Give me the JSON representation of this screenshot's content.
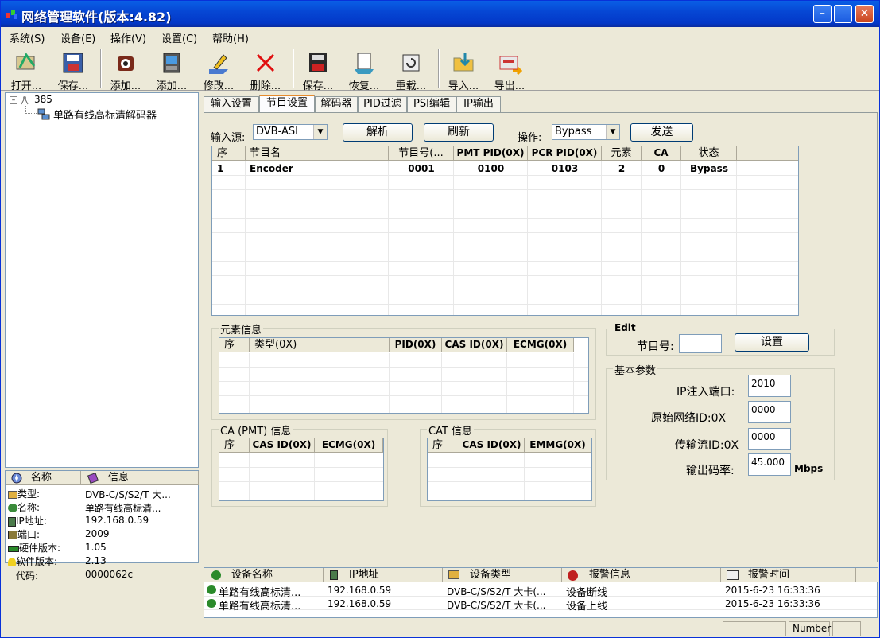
{
  "window": {
    "title": "网络管理软件(版本:4.82)",
    "min_icon": "minimize-icon",
    "max_icon": "maximize-icon",
    "close_icon": "close-icon"
  },
  "menu": [
    "系统(S)",
    "设备(E)",
    "操作(V)",
    "设置(C)",
    "帮助(H)"
  ],
  "toolbar": [
    {
      "label": "打开...",
      "icon": "open-icon"
    },
    {
      "label": "保存...",
      "icon": "save-icon"
    },
    {
      "label": "添加...",
      "icon": "add-device-icon"
    },
    {
      "label": "添加...",
      "icon": "add-window-icon"
    },
    {
      "label": "修改...",
      "icon": "edit-icon"
    },
    {
      "label": "删除...",
      "icon": "delete-icon"
    },
    {
      "label": "保存...",
      "icon": "save-disk-icon"
    },
    {
      "label": "恢复...",
      "icon": "restore-icon"
    },
    {
      "label": "重载...",
      "icon": "reload-icon"
    },
    {
      "label": "导入...",
      "icon": "import-icon"
    },
    {
      "label": "导出...",
      "icon": "export-icon"
    }
  ],
  "tree": {
    "root": "385",
    "child": "单路有线高标清解码器"
  },
  "info_panel": {
    "headers": [
      "名称",
      "信息"
    ],
    "rows": [
      {
        "name": "类型:",
        "value": "DVB-C/S/S2/T 大..."
      },
      {
        "name": "名称:",
        "value": "单路有线高标清..."
      },
      {
        "name": "IP地址:",
        "value": "192.168.0.59"
      },
      {
        "name": "端口:",
        "value": "2009"
      },
      {
        "name": "硬件版本:",
        "value": "1.05"
      },
      {
        "name": "软件版本:",
        "value": "2.13"
      },
      {
        "name": "代码:",
        "value": "0000062c"
      }
    ]
  },
  "tabs": [
    "输入设置",
    "节目设置",
    "解码器",
    "PID过滤",
    "PSI编辑",
    "IP输出"
  ],
  "active_tab": 1,
  "program": {
    "input_source_label": "输入源:",
    "input_source": "DVB-ASI",
    "parse_label": "解析",
    "refresh_label": "刷新",
    "operation_label": "操作:",
    "operation": "Bypass",
    "send_label": "发送",
    "columns": [
      "序",
      "节目名",
      "节目号(...",
      "PMT PID(0X)",
      "PCR PID(0X)",
      "元素",
      "CA",
      "状态"
    ],
    "rows": [
      [
        "1",
        "Encoder",
        "0001",
        "0100",
        "0103",
        "2",
        "0",
        "Bypass"
      ]
    ]
  },
  "elements": {
    "title": "元素信息",
    "columns": [
      "序",
      "类型(0X)",
      "PID(0X)",
      "CAS ID(0X)",
      "ECMG(0X)"
    ]
  },
  "ca_pmt": {
    "title": "CA (PMT) 信息",
    "columns": [
      "序",
      "CAS ID(0X)",
      "ECMG(0X)"
    ]
  },
  "cat": {
    "title": "CAT 信息",
    "columns": [
      "序",
      "CAS ID(0X)",
      "EMMG(0X)"
    ]
  },
  "edit": {
    "title": "Edit",
    "program_no_label": "节目号:",
    "program_no": "",
    "set_label": "设置"
  },
  "basic": {
    "title": "基本参数",
    "ip_port_label": "IP注入端口:",
    "ip_port": "2010",
    "onid_label": "原始网络ID:0X",
    "onid": "0000",
    "tsid_label": "传输流ID:0X",
    "tsid": "0000",
    "bitrate_label": "输出码率:",
    "bitrate": "45.000",
    "bitrate_unit": "Mbps"
  },
  "alarms": {
    "columns": [
      "设备名称",
      "IP地址",
      "设备类型",
      "报警信息",
      "报警时间"
    ],
    "rows": [
      [
        "单路有线高标清...",
        "192.168.0.59",
        "DVB-C/S/S2/T 大卡(...",
        "设备断线",
        "2015-6-23 16:33:36"
      ],
      [
        "单路有线高标清...",
        "192.168.0.59",
        "DVB-C/S/S2/T 大卡(...",
        "设备上线",
        "2015-6-23 16:33:36"
      ]
    ]
  },
  "status": {
    "num": "Number"
  }
}
